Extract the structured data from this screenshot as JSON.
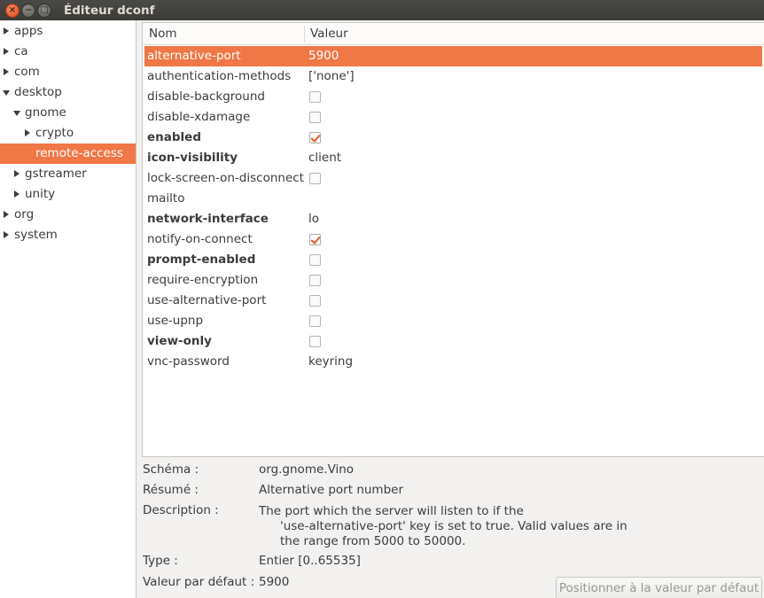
{
  "window": {
    "title": "Éditeur dconf",
    "close_glyph": "×",
    "min_glyph": "−",
    "max_glyph": "□"
  },
  "tree": [
    {
      "label": "apps",
      "expander": "collapsed",
      "depth": 0,
      "selected": false
    },
    {
      "label": "ca",
      "expander": "collapsed",
      "depth": 0,
      "selected": false
    },
    {
      "label": "com",
      "expander": "collapsed",
      "depth": 0,
      "selected": false
    },
    {
      "label": "desktop",
      "expander": "expanded",
      "depth": 0,
      "selected": false
    },
    {
      "label": "gnome",
      "expander": "expanded",
      "depth": 1,
      "selected": false
    },
    {
      "label": "crypto",
      "expander": "collapsed",
      "depth": 2,
      "selected": false
    },
    {
      "label": "remote-access",
      "expander": "none",
      "depth": 2,
      "selected": true
    },
    {
      "label": "gstreamer",
      "expander": "collapsed",
      "depth": 1,
      "selected": false
    },
    {
      "label": "unity",
      "expander": "collapsed",
      "depth": 1,
      "selected": false
    },
    {
      "label": "org",
      "expander": "collapsed",
      "depth": 0,
      "selected": false
    },
    {
      "label": "system",
      "expander": "collapsed",
      "depth": 0,
      "selected": false
    }
  ],
  "list": {
    "columns": {
      "name": "Nom",
      "value": "Valeur"
    },
    "rows": [
      {
        "name": "alternative-port",
        "bold": false,
        "type": "text",
        "value": "5900",
        "selected": true
      },
      {
        "name": "authentication-methods",
        "bold": false,
        "type": "text",
        "value": "['none']",
        "selected": false
      },
      {
        "name": "disable-background",
        "bold": false,
        "type": "check",
        "checked": false,
        "selected": false
      },
      {
        "name": "disable-xdamage",
        "bold": false,
        "type": "check",
        "checked": false,
        "selected": false
      },
      {
        "name": "enabled",
        "bold": true,
        "type": "check",
        "checked": true,
        "selected": false
      },
      {
        "name": "icon-visibility",
        "bold": true,
        "type": "text",
        "value": "client",
        "selected": false
      },
      {
        "name": "lock-screen-on-disconnect",
        "bold": false,
        "type": "check",
        "checked": false,
        "selected": false
      },
      {
        "name": "mailto",
        "bold": false,
        "type": "text",
        "value": "",
        "selected": false
      },
      {
        "name": "network-interface",
        "bold": true,
        "type": "text",
        "value": "lo",
        "selected": false
      },
      {
        "name": "notify-on-connect",
        "bold": false,
        "type": "check",
        "checked": true,
        "selected": false
      },
      {
        "name": "prompt-enabled",
        "bold": true,
        "type": "check",
        "checked": false,
        "selected": false
      },
      {
        "name": "require-encryption",
        "bold": false,
        "type": "check",
        "checked": false,
        "selected": false
      },
      {
        "name": "use-alternative-port",
        "bold": false,
        "type": "check",
        "checked": false,
        "selected": false
      },
      {
        "name": "use-upnp",
        "bold": false,
        "type": "check",
        "checked": false,
        "selected": false
      },
      {
        "name": "view-only",
        "bold": true,
        "type": "check",
        "checked": false,
        "selected": false
      },
      {
        "name": "vnc-password",
        "bold": false,
        "type": "text",
        "value": "keyring",
        "selected": false
      }
    ]
  },
  "details": {
    "schema_label": "Schéma :",
    "schema_value": "org.gnome.Vino",
    "summary_label": "Résumé :",
    "summary_value": "Alternative port number",
    "description_label": "Description :",
    "description_lines": [
      "The port which the server will listen to if the",
      "'use-alternative-port' key is set to true.  Valid values are in",
      "the range from 5000 to 50000."
    ],
    "type_label": "Type :",
    "type_value": "Entier [0..65535]",
    "default_label": "Valeur par défaut :",
    "default_value": "5900"
  },
  "reset_button": "Positionner à la valeur par défaut",
  "colors": {
    "accent": "#f07746",
    "titlebar": "#3c3b37"
  }
}
